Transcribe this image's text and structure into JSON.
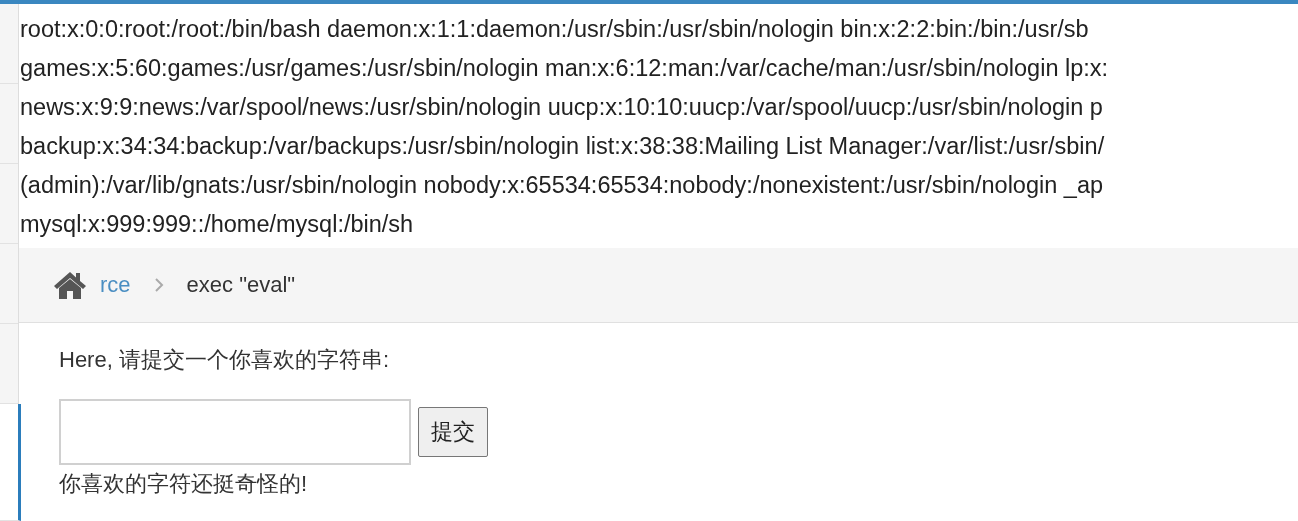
{
  "sidebar": {
    "items": [
      {
        "selected": false
      },
      {
        "selected": false
      },
      {
        "selected": false
      },
      {
        "selected": false
      },
      {
        "selected": false
      },
      {
        "selected": true
      }
    ]
  },
  "output_lines": [
    "root:x:0:0:root:/root:/bin/bash daemon:x:1:1:daemon:/usr/sbin:/usr/sbin/nologin bin:x:2:2:bin:/bin:/usr/sb",
    "games:x:5:60:games:/usr/games:/usr/sbin/nologin man:x:6:12:man:/var/cache/man:/usr/sbin/nologin lp:x:",
    "news:x:9:9:news:/var/spool/news:/usr/sbin/nologin uucp:x:10:10:uucp:/var/spool/uucp:/usr/sbin/nologin p",
    "backup:x:34:34:backup:/var/backups:/usr/sbin/nologin list:x:38:38:Mailing List Manager:/var/list:/usr/sbin/",
    "(admin):/var/lib/gnats:/usr/sbin/nologin nobody:x:65534:65534:nobody:/nonexistent:/usr/sbin/nologin _ap",
    "mysql:x:999:999::/home/mysql:/bin/sh"
  ],
  "breadcrumb": {
    "link": "rce",
    "current": "exec \"eval\""
  },
  "form": {
    "prompt": "Here, 请提交一个你喜欢的字符串:",
    "button": "提交",
    "result": "你喜欢的字符还挺奇怪的!"
  }
}
